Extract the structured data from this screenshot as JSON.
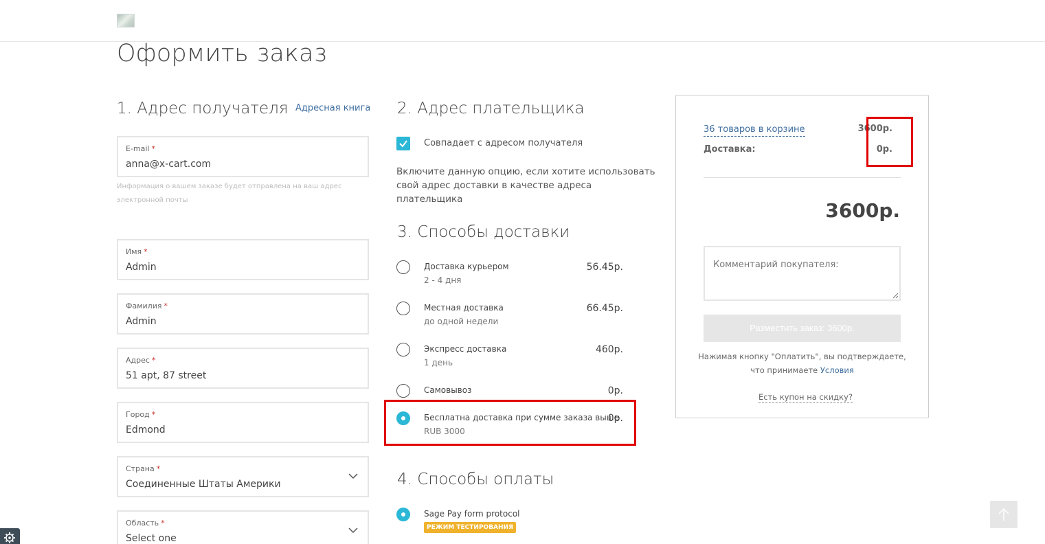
{
  "header": {
    "logo_alt": "logo"
  },
  "page": {
    "title": "Оформить заказ"
  },
  "recipient": {
    "title": "1. Адрес получателя",
    "address_book": "Адресная книга",
    "email": {
      "label": "E-mail",
      "required": "*",
      "value": "anna@x-cart.com"
    },
    "email_hint": "Информация о вашем заказе будет отправлена на ваш адрес электронной почты",
    "first_name": {
      "label": "Имя",
      "required": "*",
      "value": "Admin"
    },
    "last_name": {
      "label": "Фамилия",
      "required": "*",
      "value": "Admin"
    },
    "address": {
      "label": "Адрес",
      "required": "*",
      "value": "51 apt, 87 street"
    },
    "city": {
      "label": "Город",
      "required": "*",
      "value": "Edmond"
    },
    "country": {
      "label": "Страна",
      "required": "*",
      "value": "Соединенные Штаты Америки"
    },
    "state": {
      "label": "Область",
      "required": "*",
      "value": "Select one"
    }
  },
  "billing": {
    "title": "2. Адрес плательщика",
    "same_label": "Совпадает с адресом получателя",
    "same_checked": true,
    "description": "Включите данную опцию, если хотите использовать свой адрес доставки в качестве адреса плательщика"
  },
  "shipping": {
    "title": "3. Способы доставки",
    "methods": [
      {
        "name": "Доставка курьером",
        "sub": "2 - 4 дня",
        "price": "56.45р.",
        "selected": false
      },
      {
        "name": "Местная доставка",
        "sub": "до одной недели",
        "price": "66.45р.",
        "selected": false
      },
      {
        "name": "Экспресс доставка",
        "sub": "1 день",
        "price": "460р.",
        "selected": false
      },
      {
        "name": "Самовывоз",
        "sub": "",
        "price": "0р.",
        "selected": false
      },
      {
        "name": "Бесплатна доставка при сумме заказа выше",
        "sub": "RUB 3000",
        "price": "0р.",
        "selected": true
      }
    ]
  },
  "payment": {
    "title": "4. Способы оплаты",
    "methods": [
      {
        "name": "Sage Pay form protocol",
        "badge": "РЕЖИМ ТЕСТИРОВАНИЯ",
        "selected": true
      }
    ]
  },
  "summary": {
    "items_link": "36 товаров в корзине",
    "items_value": "3600р.",
    "shipping_label": "Доставка:",
    "shipping_value": "0р.",
    "total": "3600р.",
    "comment_placeholder": "Комментарий покупателя:",
    "place_order": "Разместить заказ: 3600р.",
    "terms_text": "Нажимая кнопку \"Оплатить\", вы подтверждаете, что принимаете",
    "terms_link": "Условия",
    "coupon_link": "Есть купон на скидку?"
  },
  "colors": {
    "accent": "#2bb7d6",
    "link": "#3f6fa0",
    "highlight": "#e00000",
    "badge": "#f0b22c"
  },
  "icons": {
    "scroll_top": "arrow-up-icon",
    "settings": "gear-icon",
    "select": "chevron-down-icon",
    "check": "check-icon"
  }
}
